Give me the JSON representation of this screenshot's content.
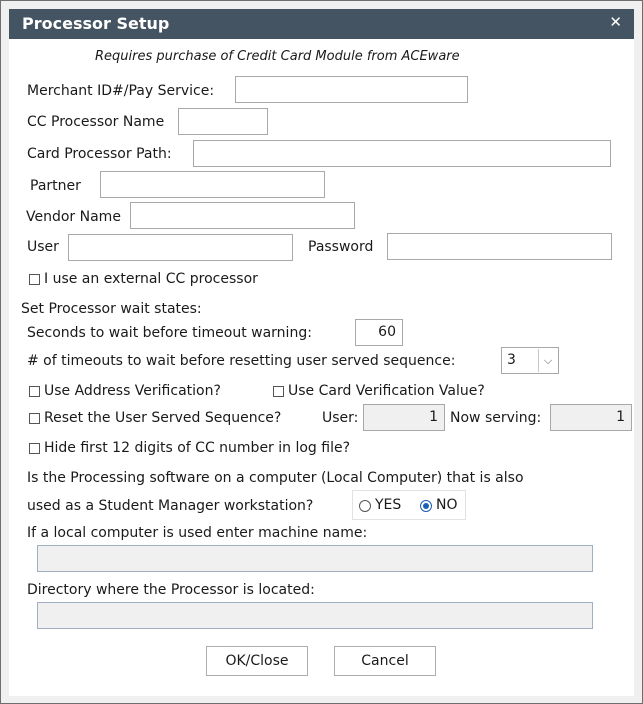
{
  "window": {
    "title": "Processor Setup"
  },
  "notice": "Requires purchase of Credit Card Module from ACEware",
  "fields": {
    "merchant_id_label": "Merchant ID#/Pay Service:",
    "merchant_id_value": "",
    "cc_processor_name_label": "CC Processor Name",
    "cc_processor_name_value": "",
    "card_processor_path_label": "Card Processor Path:",
    "card_processor_path_value": "",
    "partner_label": "Partner",
    "partner_value": "",
    "vendor_name_label": "Vendor Name",
    "vendor_name_value": "",
    "user_label": "User",
    "user_value": "",
    "password_label": "Password",
    "password_value": ""
  },
  "external_processor": {
    "label": "I use an external CC processor",
    "checked": false
  },
  "wait_states": {
    "heading": "Set Processor wait states:",
    "timeout_warning_label": "Seconds to wait before timeout warning:",
    "timeout_warning_value": "60",
    "timeouts_label": "# of timeouts to wait before resetting user served sequence:",
    "timeouts_value": "3"
  },
  "options": {
    "address_verification": "Use Address Verification?",
    "card_verification": "Use Card Verification Value?",
    "reset_sequence": "Reset the User Served Sequence?",
    "hide_digits": "Hide first 12 digits of CC number in log file?"
  },
  "sequence": {
    "user_label": "User:",
    "user_value": "1",
    "now_serving_label": "Now serving:",
    "now_serving_value": "1"
  },
  "local_computer": {
    "question_line1": "Is the Processing software on a computer (Local Computer) that is also",
    "question_line2": "used as a Student Manager workstation?",
    "yes_label": "YES",
    "no_label": "NO",
    "selected": "NO",
    "machine_name_label": "If a local computer is used enter machine name:",
    "machine_name_value": "",
    "directory_label": "Directory where the Processor is located:",
    "directory_value": ""
  },
  "buttons": {
    "ok": "OK/Close",
    "cancel": "Cancel"
  }
}
